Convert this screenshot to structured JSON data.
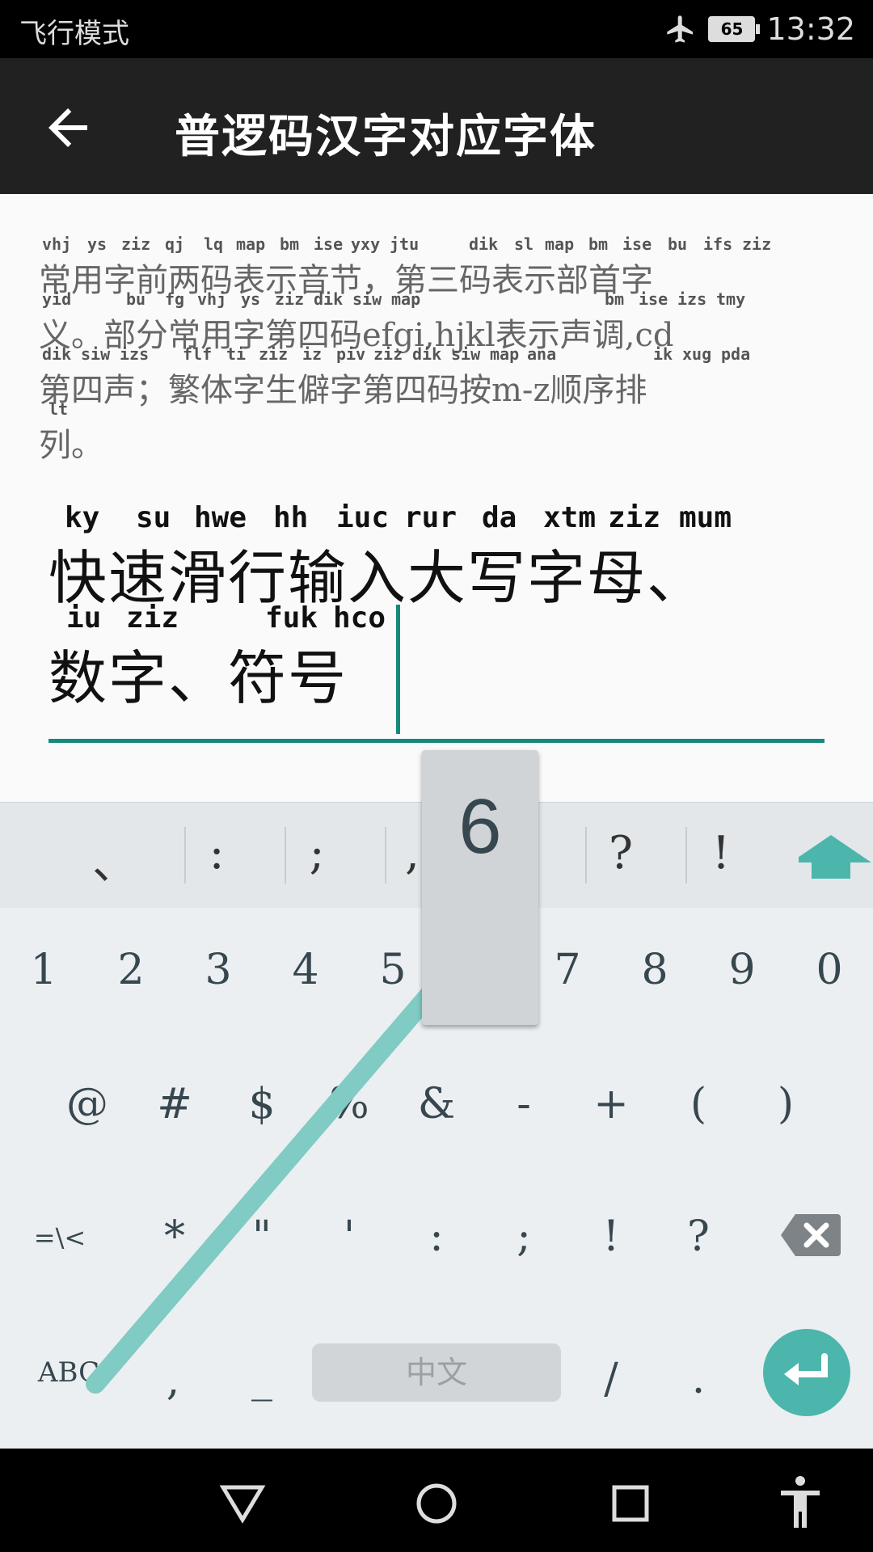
{
  "status": {
    "left": "飞行模式",
    "battery": "65",
    "time": "13:32",
    "icons": [
      "airplane-icon",
      "battery-icon"
    ]
  },
  "appbar": {
    "title": "普逻码汉字对应字体",
    "back_icon": "arrow-left-icon"
  },
  "info": {
    "lines": [
      {
        "hanzi": "常用字前两码表示音节，第三码表示部首字",
        "pins": [
          {
            "t": "vhj"
          },
          {
            "t": "ys"
          },
          {
            "t": "ziz"
          },
          {
            "t": "qj"
          },
          {
            "t": "lq"
          },
          {
            "t": "map"
          },
          {
            "t": "bm"
          },
          {
            "t": "ise"
          },
          {
            "t": "yxy"
          },
          {
            "t": "jtu"
          },
          {
            "t": "dik"
          },
          {
            "t": "sl"
          },
          {
            "t": "map"
          },
          {
            "t": "bm"
          },
          {
            "t": "ise"
          },
          {
            "t": "bu"
          },
          {
            "t": "ifs"
          },
          {
            "t": "ziz"
          }
        ]
      },
      {
        "hanzi": "义。部分常用字第四码efgi,hjkl表示声调,cd",
        "pins": [
          {
            "t": "yid"
          },
          {
            "t": "bu"
          },
          {
            "t": "fg"
          },
          {
            "t": "vhj"
          },
          {
            "t": "ys"
          },
          {
            "t": "ziz"
          },
          {
            "t": "dik"
          },
          {
            "t": "siw"
          },
          {
            "t": "map"
          },
          {
            "t": "bm"
          },
          {
            "t": "ise"
          },
          {
            "t": "izs"
          },
          {
            "t": "tmy"
          }
        ]
      },
      {
        "hanzi": "第四声；繁体字生僻字第四码按m-z顺序排",
        "pins": [
          {
            "t": "dik"
          },
          {
            "t": "siw"
          },
          {
            "t": "izs"
          },
          {
            "t": "flf"
          },
          {
            "t": "ti"
          },
          {
            "t": "ziz"
          },
          {
            "t": "iz"
          },
          {
            "t": "piv"
          },
          {
            "t": "ziz"
          },
          {
            "t": "dik"
          },
          {
            "t": "siw"
          },
          {
            "t": "map"
          },
          {
            "t": "ana"
          },
          {
            "t": "ik"
          },
          {
            "t": "xug"
          },
          {
            "t": "pda"
          }
        ]
      },
      {
        "hanzi": "列。",
        "pins": [
          {
            "t": "lt"
          }
        ]
      }
    ]
  },
  "input": {
    "lines": [
      {
        "hanzi": "快速滑行输入大写字母、",
        "pins": [
          {
            "t": "ky"
          },
          {
            "t": "su"
          },
          {
            "t": "hwe"
          },
          {
            "t": "hh"
          },
          {
            "t": "iuc"
          },
          {
            "t": "rur"
          },
          {
            "t": "da"
          },
          {
            "t": "xtm"
          },
          {
            "t": "ziz"
          },
          {
            "t": "mum"
          }
        ]
      },
      {
        "hanzi": "数字、符号",
        "pins": [
          {
            "t": "iu"
          },
          {
            "t": "ziz"
          },
          {
            "t": "fuk"
          },
          {
            "t": "hco"
          }
        ]
      }
    ]
  },
  "keyboard": {
    "symbol_row": [
      "、",
      ":",
      ";",
      ",",
      "6",
      "?",
      "!"
    ],
    "shift_icon": "shift-up-arrow-icon",
    "row1": [
      "1",
      "2",
      "3",
      "4",
      "5",
      "6",
      "7",
      "8",
      "9",
      "0"
    ],
    "row2": [
      "@",
      "#",
      "$",
      "%",
      "&",
      "-",
      "+",
      "(",
      ")"
    ],
    "row3": [
      "=\\<",
      "*",
      "\"",
      "'",
      ":",
      ";",
      "!",
      "?"
    ],
    "backspace_icon": "backspace-icon",
    "row4": {
      "abc": "ABC",
      "comma": ",",
      "underscore": "_",
      "space": "中文",
      "slash": "/",
      "period": "."
    },
    "enter_icon": "enter-icon",
    "popup_key": "6",
    "accent": "#4db6ac",
    "underline_color": "#17897b"
  },
  "navbar": {
    "icons": [
      "back-triangle-icon",
      "home-circle-icon",
      "recents-square-icon",
      "accessibility-icon"
    ]
  }
}
